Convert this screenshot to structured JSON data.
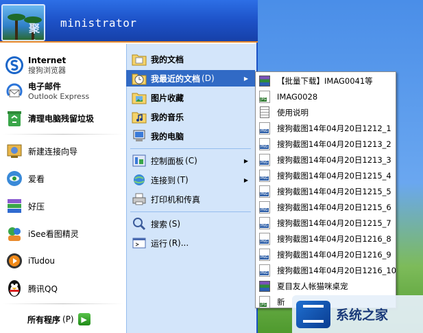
{
  "user": {
    "name": "ministrator",
    "avatar_text": "聚会00"
  },
  "pinned": [
    {
      "title": "Internet",
      "subtitle": "搜狗浏览器",
      "icon": "sogou-browser-icon"
    },
    {
      "title": "电子邮件",
      "subtitle": "Outlook Express",
      "icon": "outlook-express-icon"
    }
  ],
  "recent_programs": [
    {
      "label": "清理电脑残留垃圾",
      "icon": "recycle-bin-icon"
    },
    {
      "label": "新建连接向导",
      "icon": "connection-wizard-icon"
    },
    {
      "label": "爱看",
      "icon": "aikan-icon"
    },
    {
      "label": "好压",
      "icon": "haozip-icon"
    },
    {
      "label": "iSee看图精灵",
      "icon": "isee-viewer-icon"
    },
    {
      "label": "iTudou",
      "icon": "itudou-icon"
    },
    {
      "label": "腾讯QQ",
      "icon": "qq-penguin-icon"
    }
  ],
  "all_programs": {
    "label": "所有程序",
    "accel": "(P)"
  },
  "right_pane": {
    "my_documents": "我的文档",
    "recent_documents": "我最近的文档",
    "recent_documents_accel": "(D)",
    "my_pictures": "图片收藏",
    "my_music": "我的音乐",
    "my_computer": "我的电脑",
    "control_panel": "控制面板",
    "control_panel_accel": "(C)",
    "connect_to": "连接到",
    "connect_to_accel": "(T)",
    "printers": "打印机和传真",
    "search": "搜索",
    "search_accel": "(S)",
    "run": "运行",
    "run_accel": "(R)..."
  },
  "recent_documents": [
    {
      "label": "【批量下载】IMAG0041等",
      "type": "rar"
    },
    {
      "label": "IMAG0028",
      "type": "jpg"
    },
    {
      "label": "使用说明",
      "type": "txt"
    },
    {
      "label": "搜狗截图14年04月20日1212_1",
      "type": "png"
    },
    {
      "label": "搜狗截图14年04月20日1213_2",
      "type": "png"
    },
    {
      "label": "搜狗截图14年04月20日1213_3",
      "type": "png"
    },
    {
      "label": "搜狗截图14年04月20日1215_4",
      "type": "png"
    },
    {
      "label": "搜狗截图14年04月20日1215_5",
      "type": "png"
    },
    {
      "label": "搜狗截图14年04月20日1215_6",
      "type": "png"
    },
    {
      "label": "搜狗截图14年04月20日1215_7",
      "type": "png"
    },
    {
      "label": "搜狗截图14年04月20日1216_8",
      "type": "png"
    },
    {
      "label": "搜狗截图14年04月20日1216_9",
      "type": "png"
    },
    {
      "label": "搜狗截图14年04月20日1216_10",
      "type": "png"
    },
    {
      "label": "夏目友人帐猫咪桌宠",
      "type": "rar"
    },
    {
      "label": "新",
      "type": "jpg"
    }
  ],
  "watermark": {
    "text": "系统之家"
  },
  "colors": {
    "header_blue": "#1d52c8",
    "highlight": "#316ac5",
    "right_pane_bg": "#d3e5fa"
  }
}
